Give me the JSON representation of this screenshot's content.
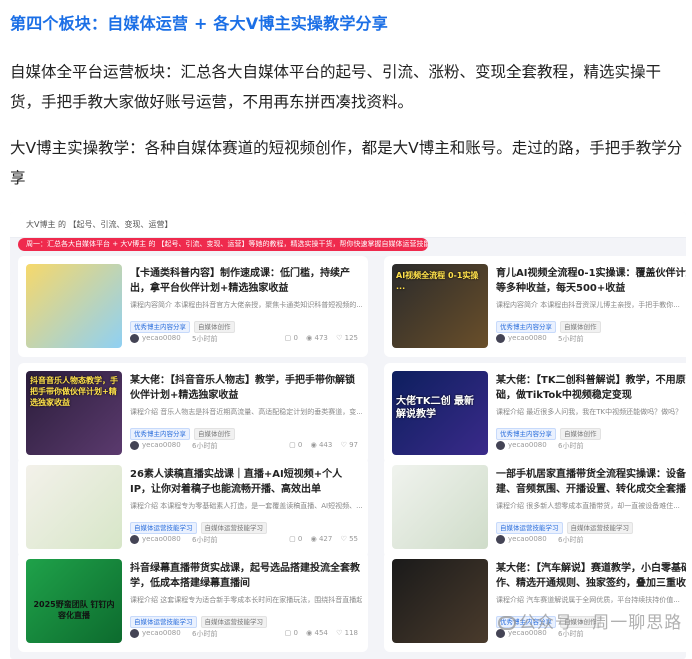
{
  "heading": "第四个板块：自媒体运营 + 各大V博主实操教学分享",
  "para1": "自媒体全平台运营板块：汇总各大自媒体平台的起号、引流、涨粉、变现全套教程，精选实操干货，手把手教大家做好账号运营，不用再东拼西凑找资料。",
  "para2": "大V博主实操教学：各种自媒体赛道的短视频创作，都是大V博主和账号。走过的路，手把手教学分享",
  "screenshot": {
    "breadcrumb": "大V博主 的 【起号、引流、变现、运营】",
    "banner": "周一：汇总各大自媒体平台 + 大V博主 的 【起号、引流、变现、运营】等她的教程，精选实操干货，帮你快速掌握自媒体运营技能",
    "cards": [
      {
        "thumb_text": "",
        "title": "【卡通类科普内容】制作速成课：低门槛，持续产出，拿平台伙伴计划+精选独家收益",
        "desc": "课程内容简介 本课程由抖音官方大佬亲授，聚焦卡通类知识科普短视频的...",
        "tags": [
          "优秀博主内容分享",
          "自媒体创作"
        ],
        "author": "yecao0080",
        "time": "5小时前",
        "stats": [
          "0",
          "473",
          "125"
        ]
      },
      {
        "thumb_text": "AI视频全流程 0-1实操 ...",
        "title": "育儿AI视频全流程0-1实操课：覆盖伙伴计划+分销等多种收益，每天500+收益",
        "desc": "课程内容简介 本课程由抖音资深儿博主亲授，手把手教你...",
        "tags": [
          "优秀博主内容分享",
          "自媒体创作"
        ],
        "author": "yecao0080",
        "time": "5小时前",
        "stats": []
      },
      {
        "thumb_text": "抖音音乐人物态教学，手把手带你做伙伴计划+精选独家收益",
        "title": "某大佬：【抖音音乐人物志】教学，手把手带你解锁伙伴计划+精选独家收益",
        "desc": "课程介绍 音乐人物志是抖音近期高流量、高适配稳定计划的垂类赛道，变...",
        "tags": [
          "优秀博主内容分享",
          "自媒体创作"
        ],
        "author": "yecao0080",
        "time": "6小时前",
        "stats": [
          "0",
          "443",
          "97"
        ]
      },
      {
        "thumb_text": "大佬TK二创 最新解说教学",
        "title": "某大佬：【TK二创科普解说】教学，不用原创拍摄基础，做TikTok中视频稳定变现",
        "desc": "课程介绍 最近很多人问我，我在TK中视频还能做吗？做吗？",
        "tags": [
          "优秀博主内容分享",
          "自媒体创作"
        ],
        "author": "yecao0080",
        "time": "6小时前",
        "stats": []
      },
      {
        "thumb_text": "",
        "title": "26素人读稿直播实战课｜直播+AI短视频+个人IP，让你对着稿子也能流畅开播、高效出单",
        "desc": "课程介绍 本课程专为零基础素人打造，是一套覆盖读稿直播、AI短视频、...",
        "tags": [
          "自媒体运营技能学习",
          "自媒体运营技能学习"
        ],
        "author": "yecao0080",
        "time": "6小时前",
        "stats": [
          "0",
          "427",
          "55"
        ]
      },
      {
        "thumb_text": "",
        "title": "一部手机居家直播带货全流程实操课：设备调试、搭建、音频氛围、开播设置、转化成交全套播学",
        "desc": "课程介绍 很多新人想零成本直播带货，却一直被设备难住...",
        "tags": [
          "自媒体运营技能学习",
          "自媒体运营技能学习"
        ],
        "author": "yecao0080",
        "time": "6小时前",
        "stats": []
      },
      {
        "thumb_text": "2025野蛮团队 钉钉内容化直播",
        "title": "抖音绿幕直播带货实战课，起号选品搭建投流全套教学，低成本搭建绿幕直播间",
        "desc": "课程介绍 这套课程专为适合新手零成本长时间在家播玩法，围绕抖音直播起号场景...",
        "tags": [
          "自媒体运营技能学习",
          "自媒体运营技能学习"
        ],
        "author": "yecao0080",
        "time": "6小时前",
        "stats": [
          "0",
          "454",
          "118"
        ]
      },
      {
        "thumb_text": "",
        "title": "某大佬：【汽车解说】赛道教学，小白零基础可操作、精选开通规则、独家签约，叠加三重收益",
        "desc": "课程介绍 汽车赛道解说属于全网优质，平台持续扶持价值...",
        "tags": [
          "优秀博主内容分享",
          "自媒体创作"
        ],
        "author": "yecao0080",
        "time": "6小时前",
        "stats": []
      }
    ]
  },
  "watermark": "公众号 · 周一聊思路",
  "colors": {
    "heading": "#1b6fe6",
    "banner": "#ef2a4d"
  }
}
